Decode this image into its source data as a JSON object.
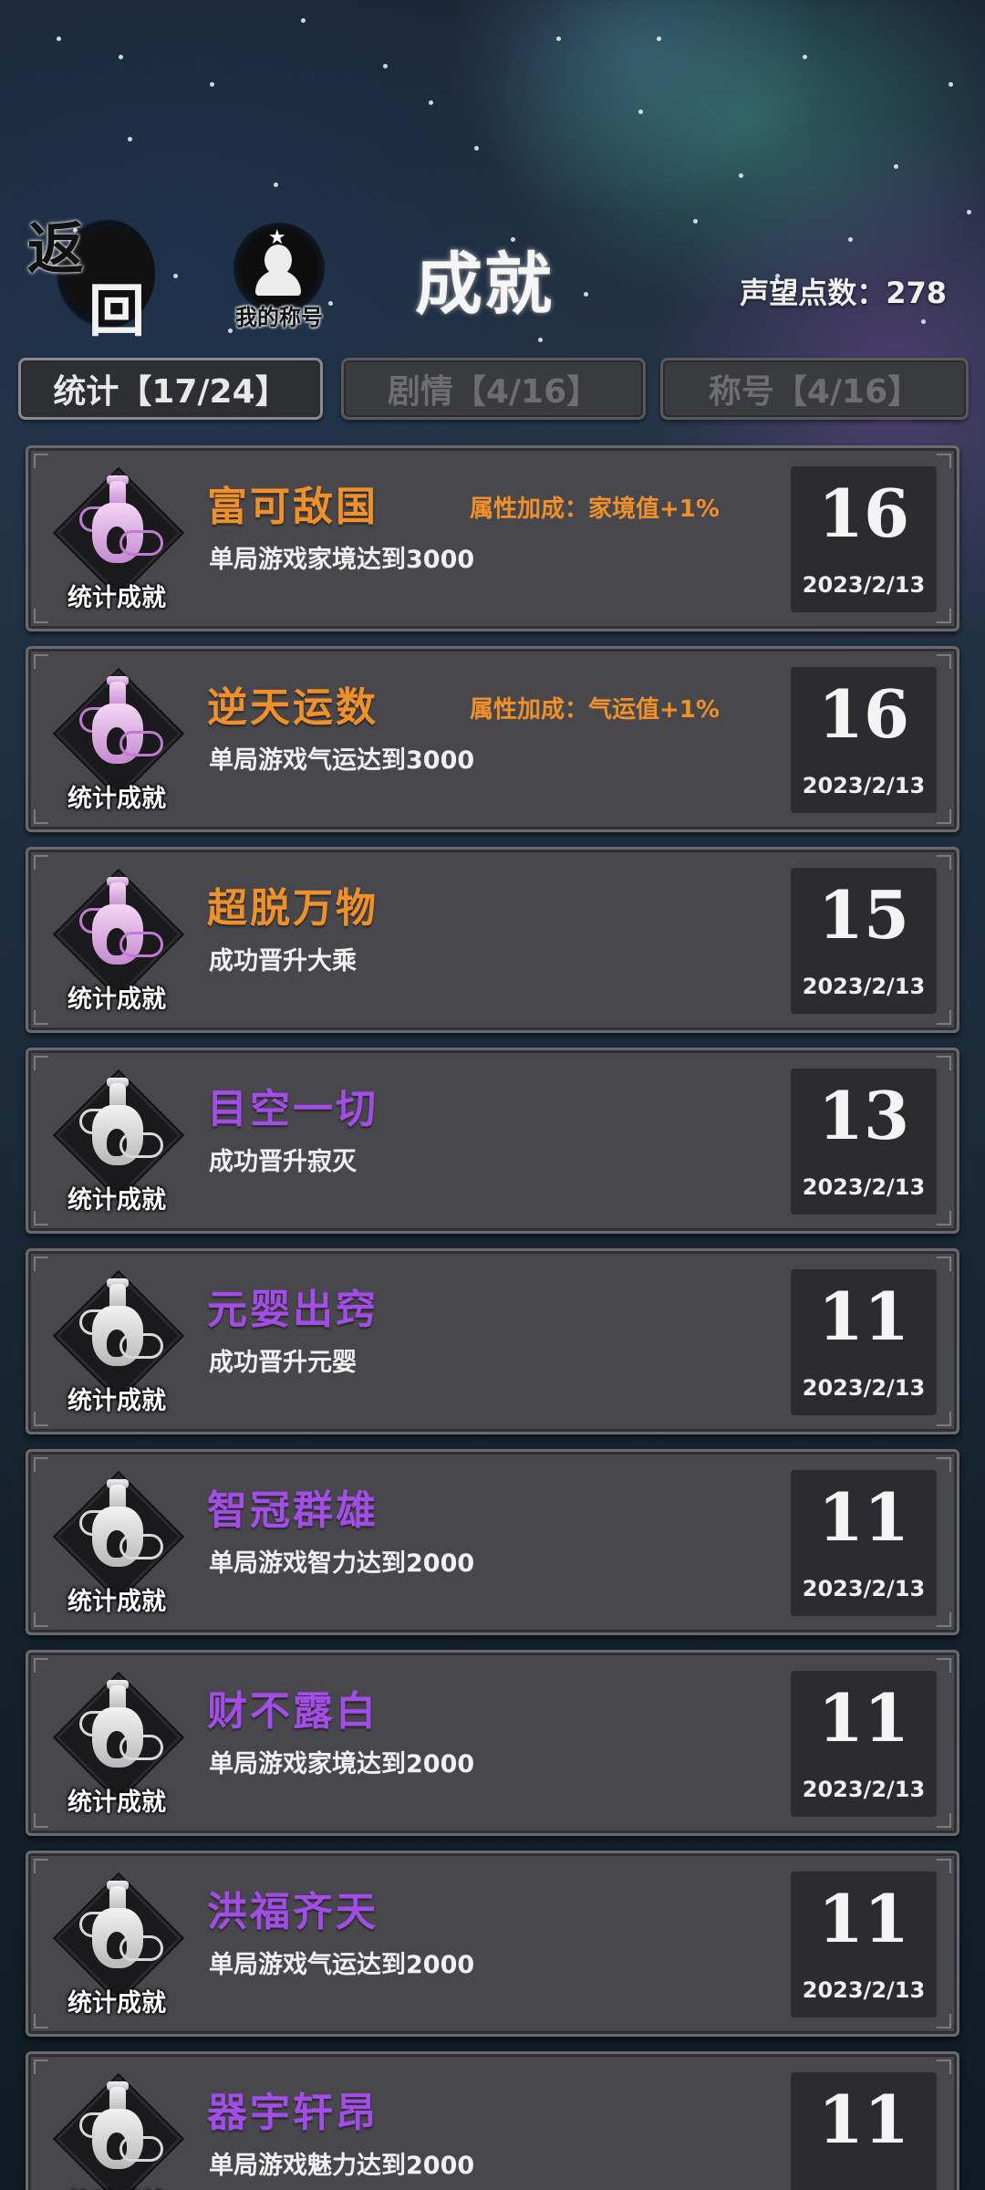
{
  "header": {
    "back_char_1": "返",
    "back_char_2": "回",
    "my_title_label": "我的称号",
    "page_title": "成就",
    "prestige_label": "声望点数：",
    "prestige_value": "278"
  },
  "tabs": [
    {
      "label": "统计【17/24】",
      "active": true
    },
    {
      "label": "剧情【4/16】",
      "active": false
    },
    {
      "label": "称号【4/16】",
      "active": false
    }
  ],
  "achievements": [
    {
      "badge": "统计成就",
      "badge_style": "pink-vase-icon",
      "name": "富可敌国",
      "name_color": "#f0902a",
      "bonus": "属性加成：家境值+1%",
      "desc": "单局游戏家境达到3000",
      "points": "16",
      "date": "2023/2/13"
    },
    {
      "badge": "统计成就",
      "badge_style": "pink-vase-icon",
      "name": "逆天运数",
      "name_color": "#f0902a",
      "bonus": "属性加成：气运值+1%",
      "desc": "单局游戏气运达到3000",
      "points": "16",
      "date": "2023/2/13"
    },
    {
      "badge": "统计成就",
      "badge_style": "pink-vase-icon",
      "name": "超脱万物",
      "name_color": "#f0902a",
      "bonus": "",
      "desc": "成功晋升大乘",
      "points": "15",
      "date": "2023/2/13"
    },
    {
      "badge": "统计成就",
      "badge_style": "gray-vase-icon",
      "name": "目空一切",
      "name_color": "#a24ee6",
      "bonus": "",
      "desc": "成功晋升寂灭",
      "points": "13",
      "date": "2023/2/13"
    },
    {
      "badge": "统计成就",
      "badge_style": "gray-vase-icon",
      "name": "元婴出窍",
      "name_color": "#a24ee6",
      "bonus": "",
      "desc": "成功晋升元婴",
      "points": "11",
      "date": "2023/2/13"
    },
    {
      "badge": "统计成就",
      "badge_style": "gray-vase-icon",
      "name": "智冠群雄",
      "name_color": "#a24ee6",
      "bonus": "",
      "desc": "单局游戏智力达到2000",
      "points": "11",
      "date": "2023/2/13"
    },
    {
      "badge": "统计成就",
      "badge_style": "gray-vase-icon",
      "name": "财不露白",
      "name_color": "#a24ee6",
      "bonus": "",
      "desc": "单局游戏家境达到2000",
      "points": "11",
      "date": "2023/2/13"
    },
    {
      "badge": "统计成就",
      "badge_style": "gray-vase-icon",
      "name": "洪福齐天",
      "name_color": "#a24ee6",
      "bonus": "",
      "desc": "单局游戏气运达到2000",
      "points": "11",
      "date": "2023/2/13"
    },
    {
      "badge": "统计成就",
      "badge_style": "gray-vase-icon",
      "name": "器宇轩昂",
      "name_color": "#a24ee6",
      "bonus": "",
      "desc": "单局游戏魅力达到2000",
      "points": "11",
      "date": ""
    }
  ]
}
